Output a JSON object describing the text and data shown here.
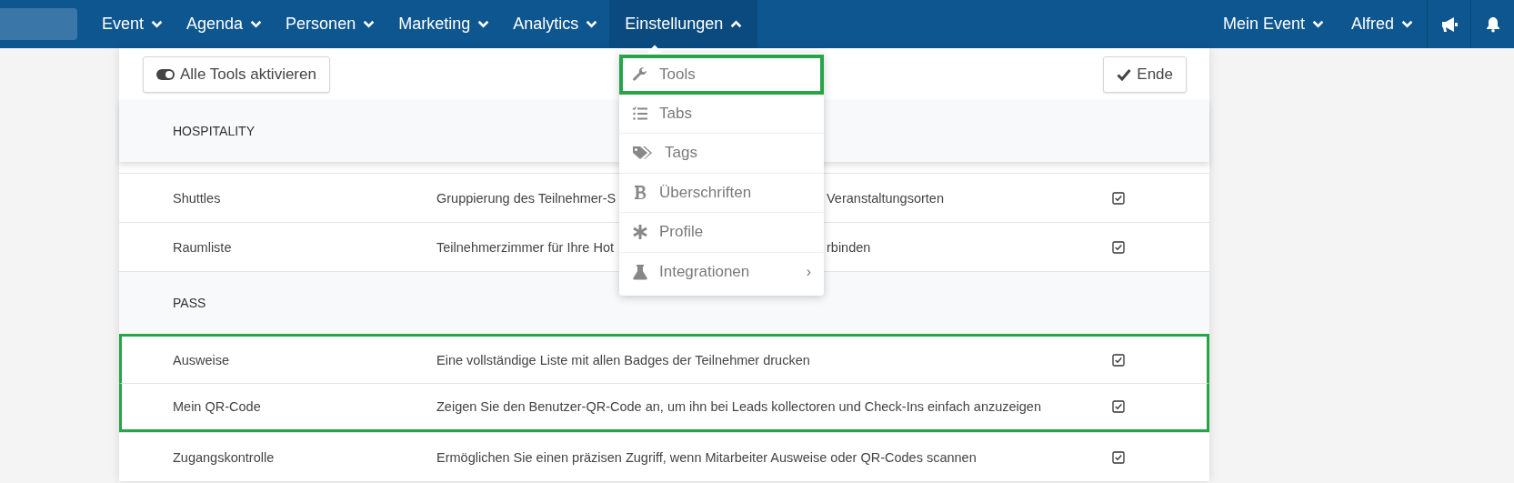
{
  "nav": {
    "items": [
      {
        "label": "Event",
        "open": false
      },
      {
        "label": "Agenda",
        "open": false
      },
      {
        "label": "Personen",
        "open": false
      },
      {
        "label": "Marketing",
        "open": false
      },
      {
        "label": "Analytics",
        "open": false
      },
      {
        "label": "Einstellungen",
        "open": true
      }
    ],
    "right_items": [
      {
        "label": "Mein Event"
      },
      {
        "label": "Alfred"
      }
    ]
  },
  "toolbar": {
    "toggle_button": "Alle Tools aktivieren",
    "done_button": "Ende"
  },
  "sections": [
    {
      "title": "HOSPITALITY",
      "rows": [
        {
          "name": "Shuttles",
          "description": "Gruppierung des Teilnehmer-S",
          "description_after": "Veranstaltungsorten",
          "checked": true,
          "highlighted": false
        },
        {
          "name": "Raumliste",
          "description": "Teilnehmerzimmer für Ihre Hot",
          "description_after": "rbinden",
          "checked": true,
          "highlighted": false
        }
      ]
    },
    {
      "title": "PASS",
      "rows": [
        {
          "name": "Ausweise",
          "description": "Eine vollständige Liste mit allen Badges der Teilnehmer drucken",
          "checked": true,
          "highlighted": true
        },
        {
          "name": "Mein QR-Code",
          "description": "Zeigen Sie den Benutzer-QR-Code an, um ihn bei Leads kollectoren und Check-Ins einfach anzuzeigen",
          "checked": true,
          "highlighted": true
        },
        {
          "name": "Zugangskontrolle",
          "description": "Ermöglichen Sie einen präzisen Zugriff, wenn Mitarbeiter Ausweise oder QR-Codes scannen",
          "checked": true,
          "highlighted": false
        }
      ]
    }
  ],
  "dropdown": {
    "items": [
      {
        "kind": "wrench",
        "label": "Tools",
        "highlighted": true
      },
      {
        "kind": "checklist",
        "label": "Tabs",
        "highlighted": false
      },
      {
        "kind": "tags",
        "label": "Tags",
        "highlighted": false
      },
      {
        "kind": "bold",
        "label": "Überschriften",
        "highlighted": false
      },
      {
        "kind": "asterisk",
        "label": "Profile",
        "highlighted": false
      },
      {
        "kind": "flask",
        "label": "Integrationen",
        "highlighted": false,
        "submenu_mark": "›"
      }
    ]
  }
}
